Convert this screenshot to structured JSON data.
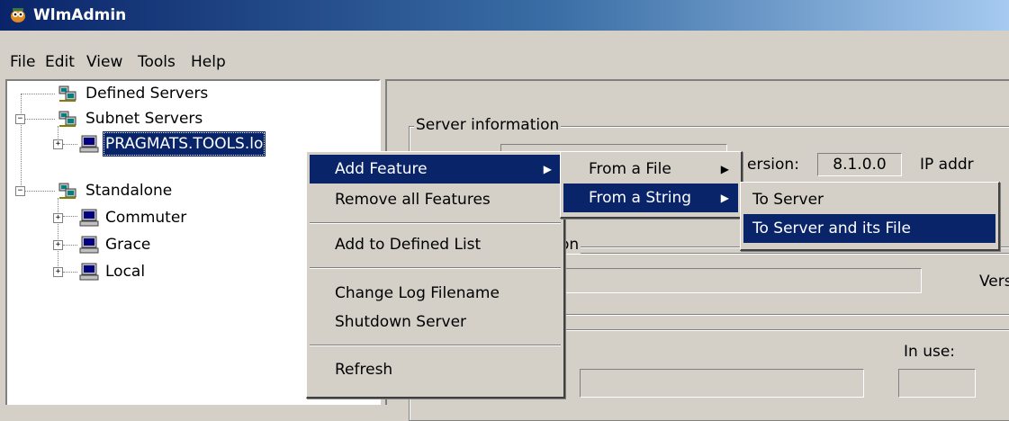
{
  "window": {
    "title": "WlmAdmin"
  },
  "menubar": {
    "items": [
      "File",
      "Edit",
      "View",
      "Tools",
      "Help"
    ]
  },
  "tree": {
    "defined_servers": "Defined Servers",
    "subnet_servers": "Subnet Servers",
    "pragmats": "PRAGMATS.TOOLS.lo",
    "standalone": "Standalone",
    "commuter": "Commuter",
    "grace": "Grace",
    "local": "Local"
  },
  "right_panel": {
    "server_information_label": "Server information",
    "version_label": "ersion:",
    "version_value": "8.1.0.0",
    "ip_label": "IP addr",
    "section2_label": "on",
    "vers_label": "Vers",
    "in_use_label": "In use:"
  },
  "context_menu": {
    "items": [
      "Add Feature",
      "Remove all Features",
      "Add to Defined List",
      "Change Log Filename",
      "Shutdown Server",
      "Refresh"
    ]
  },
  "submenu_add_feature": {
    "items": [
      "From a File",
      "From a String"
    ]
  },
  "submenu_from_string": {
    "items": [
      "To Server",
      "To Server and its File"
    ]
  },
  "colors": {
    "highlight": "#0a246a",
    "face": "#d4d0c8"
  }
}
